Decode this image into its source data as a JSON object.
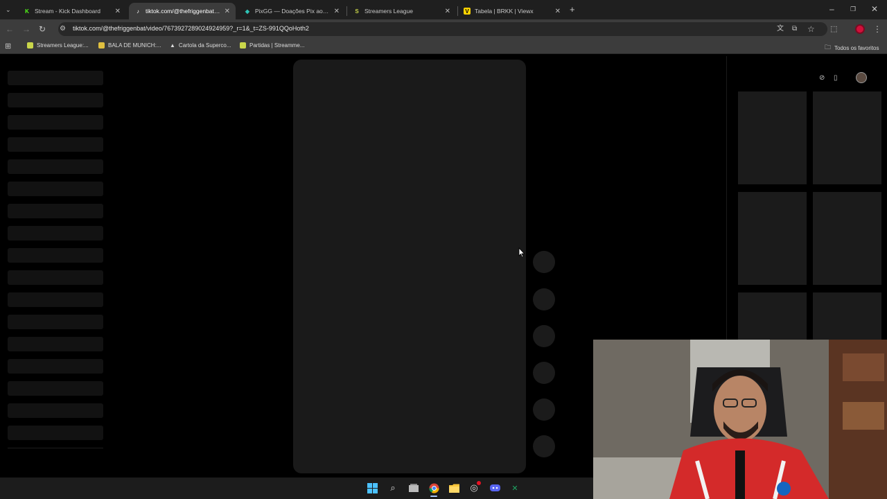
{
  "tabs": [
    {
      "title": "Stream - Kick Dashboard",
      "icon": "kick-icon",
      "color": "#53fc18",
      "letter": "K"
    },
    {
      "title": "tiktok.com/@thefriggenbat/vid",
      "icon": "tiktok-icon",
      "color": "#ffffff",
      "letter": "♪"
    },
    {
      "title": "PixGG — Doações Pix ao vivo p",
      "icon": "pixgg-icon",
      "color": "#2ec4b6",
      "letter": "◆"
    },
    {
      "title": "Streamers League",
      "icon": "streamers-league-icon",
      "color": "#c9d64a",
      "letter": "S"
    },
    {
      "title": "Tabela | BRKK | Viewx",
      "icon": "viewx-icon",
      "color": "#ffd400",
      "letter": "V"
    }
  ],
  "address": {
    "url": "tiktok.com/@thefriggenbat/video/7673927289024924959?_r=1&_t=ZS-991QQoHoth2"
  },
  "bookmarks": [
    {
      "label": "Streamers League:...",
      "color": "#c9d64a"
    },
    {
      "label": "BALA DE MUNICH:...",
      "color": "#e0c040"
    },
    {
      "label": "Cartola da Superco...",
      "color": "#ffffff"
    },
    {
      "label": "Partidas | Streamme...",
      "color": "#c9d64a"
    }
  ],
  "all_bookmarks_label": "Todos os favoritos",
  "colors": {
    "accent": "#a8c7fa",
    "profile": "#d0103a"
  }
}
